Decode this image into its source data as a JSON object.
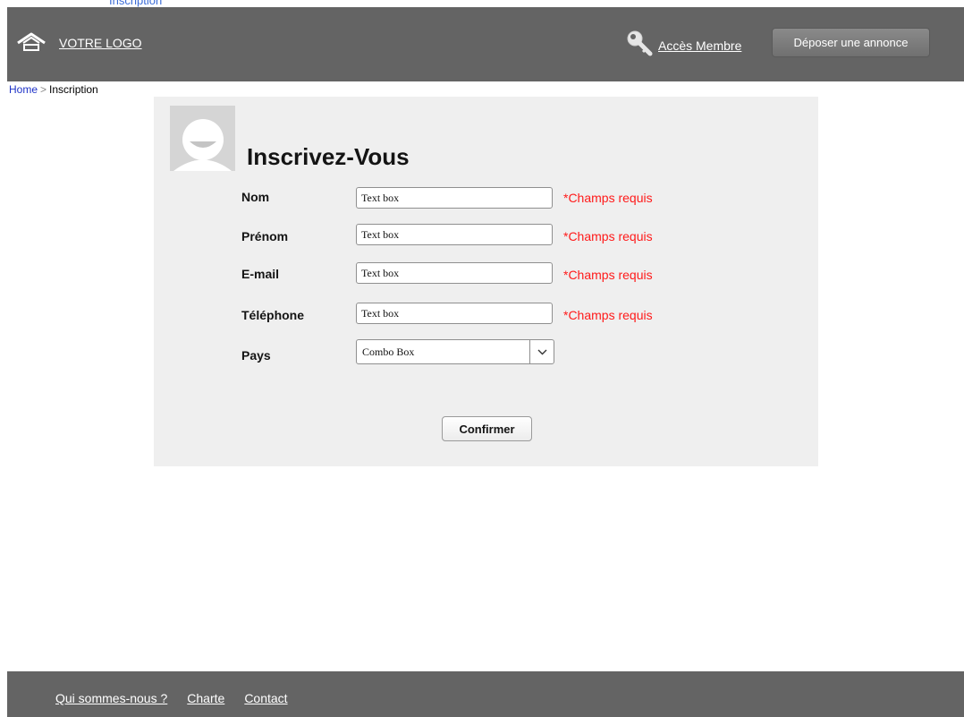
{
  "top_clip_text": "Inscription",
  "header": {
    "logo_label": "VOTRE LOGO",
    "logo_icon": "home-icon",
    "member_label": "Accès Membre",
    "member_icon": "key-icon",
    "post_button_label": "Déposer une annonce"
  },
  "breadcrumb": {
    "home": "Home",
    "separator": ">",
    "current": "Inscription"
  },
  "form": {
    "title": "Inscrivez-Vous",
    "fields": [
      {
        "label": "Nom",
        "value": "Text box",
        "required": "*Champs requis"
      },
      {
        "label": "Prénom",
        "value": "Text box",
        "required": "*Champs requis"
      },
      {
        "label": "E-mail",
        "value": "Text box",
        "required": "*Champs requis"
      },
      {
        "label": "Téléphone",
        "value": "Text box",
        "required": "*Champs requis"
      }
    ],
    "country": {
      "label": "Pays",
      "value": "Combo Box"
    },
    "confirm_label": "Confirmer"
  },
  "footer": {
    "links": [
      "Qui sommes-nous ?",
      "Charte",
      "Contact"
    ]
  },
  "colors": {
    "header_bg": "#646464",
    "panel_bg": "#efefef",
    "required_red": "#ff1a1a",
    "link_blue": "#1f33c8"
  }
}
